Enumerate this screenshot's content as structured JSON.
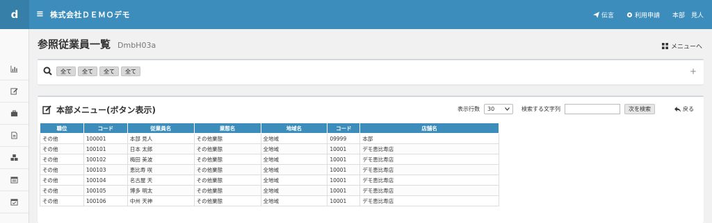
{
  "header": {
    "logo": "d",
    "menu_icon": "≡",
    "company": "株式会社ＤＥＭＯデモ",
    "links": [
      {
        "icon": "paper-plane-icon",
        "label": "伝言"
      },
      {
        "icon": "gear-icon",
        "label": "利用申請"
      },
      {
        "icon": "user-icon",
        "label": "本部　見人"
      }
    ]
  },
  "sidebar": {
    "items": [
      {
        "icon": "bar-chart-icon"
      },
      {
        "icon": "edit-icon"
      },
      {
        "icon": "briefcase-icon"
      },
      {
        "icon": "document-icon"
      },
      {
        "icon": "cubes-icon"
      },
      {
        "icon": "calendar-icon"
      },
      {
        "icon": "calendar-check-icon"
      }
    ]
  },
  "page": {
    "title": "参照従業員一覧",
    "code": "DmbH03a",
    "menu_link": "メニューへ"
  },
  "filter": {
    "chips": [
      "全て",
      "全て",
      "全て",
      "全て"
    ],
    "plus": "+"
  },
  "list": {
    "title": "本部メニュー(ボタン表示)",
    "rows_label": "表示行数",
    "rows_value": "30",
    "search_label": "検索する文字列",
    "search_value": "",
    "search_button": "次を検索",
    "back_label": "戻る",
    "columns": [
      "職位",
      "コード",
      "従業員名",
      "業態名",
      "地域名",
      "コード",
      "店舗名"
    ],
    "rows": [
      [
        "その他",
        "100001",
        "本部 見人",
        "その他業態",
        "全地域",
        "09999",
        "本部"
      ],
      [
        "その他",
        "100101",
        "日本 太郎",
        "その他業態",
        "全地域",
        "10001",
        "デモ恵比寿店"
      ],
      [
        "その他",
        "100102",
        "梅田 美波",
        "その他業態",
        "全地域",
        "10001",
        "デモ恵比寿店"
      ],
      [
        "その他",
        "100103",
        "恵比寿 咲",
        "その他業態",
        "全地域",
        "10001",
        "デモ恵比寿店"
      ],
      [
        "その他",
        "100104",
        "名古屋 天",
        "その他業態",
        "全地域",
        "10001",
        "デモ恵比寿店"
      ],
      [
        "その他",
        "100105",
        "博多 明太",
        "その他業態",
        "全地域",
        "10001",
        "デモ恵比寿店"
      ],
      [
        "その他",
        "100106",
        "中州 天神",
        "その他業態",
        "全地域",
        "10001",
        "デモ恵比寿店"
      ]
    ]
  },
  "colors": {
    "header": "#3c8dbc",
    "logo_bg": "#367fa9",
    "table_header": "#3c8dbc"
  }
}
